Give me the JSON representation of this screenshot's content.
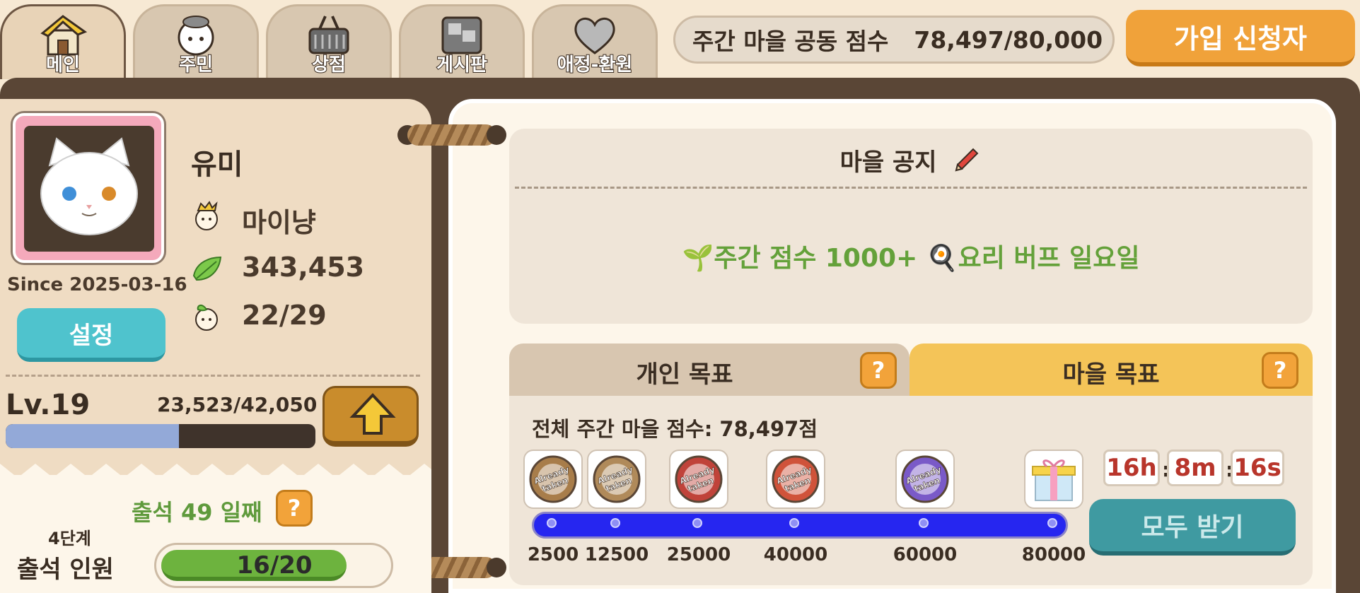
{
  "tabs": [
    {
      "label": "메인",
      "icon": "house-icon",
      "active": true
    },
    {
      "label": "주민",
      "icon": "resident-icon",
      "active": false
    },
    {
      "label": "상점",
      "icon": "basket-icon",
      "active": false
    },
    {
      "label": "게시판",
      "icon": "board-icon",
      "active": false
    },
    {
      "label": "애정-환원",
      "icon": "heart-icon",
      "active": false
    }
  ],
  "weekly_score": {
    "label": "주간 마을 공동 점수",
    "value": "78,497/80,000"
  },
  "apply_button": "가입 신청자",
  "profile": {
    "name": "유미",
    "title": "마이냥",
    "leaves": "343,453",
    "sprouts": "22/29",
    "since": "Since 2025-03-16",
    "settings_label": "설정"
  },
  "level": {
    "label": "Lv.19",
    "xp": "23,523/42,050",
    "progress": 0.5594
  },
  "attendance": {
    "days_label": "출석 49 일째",
    "stage": "4단계",
    "label": "출석 인원",
    "count": "16/20",
    "progress": 0.8
  },
  "notice": {
    "title": "마을 공지",
    "text": "🌱주간 점수 1000+ 🍳요리 버프 일요일"
  },
  "goal_tabs": {
    "personal": "개인 목표",
    "village": "마을 목표",
    "active": "village"
  },
  "goal": {
    "total_label": "전체 주간 마을 점수: 78,497점",
    "progress": 0.981,
    "milestones": [
      {
        "value": 2500,
        "label": "2500",
        "status": "Already taken",
        "color": "#a87d4a"
      },
      {
        "value": 12500,
        "label": "12500",
        "status": "Already taken",
        "color": "#b08a5a"
      },
      {
        "value": 25000,
        "label": "25000",
        "status": "Already taken",
        "color": "#c0433a"
      },
      {
        "value": 40000,
        "label": "40000",
        "status": "Already taken",
        "color": "#d0533a"
      },
      {
        "value": 60000,
        "label": "60000",
        "status": "Already taken",
        "color": "#7a5ac8"
      },
      {
        "value": 80000,
        "label": "80000",
        "status": "gift",
        "color": "#f7d34a"
      }
    ],
    "timer": {
      "hours": "16h",
      "minutes": "8m",
      "seconds": "16s"
    },
    "claim_all": "모두 받기"
  },
  "colors": {
    "frame": "#5a4636",
    "accent_orange": "#f0a23a",
    "teal": "#4fc3cd",
    "green": "#64a13a",
    "track": "#2626f0"
  }
}
